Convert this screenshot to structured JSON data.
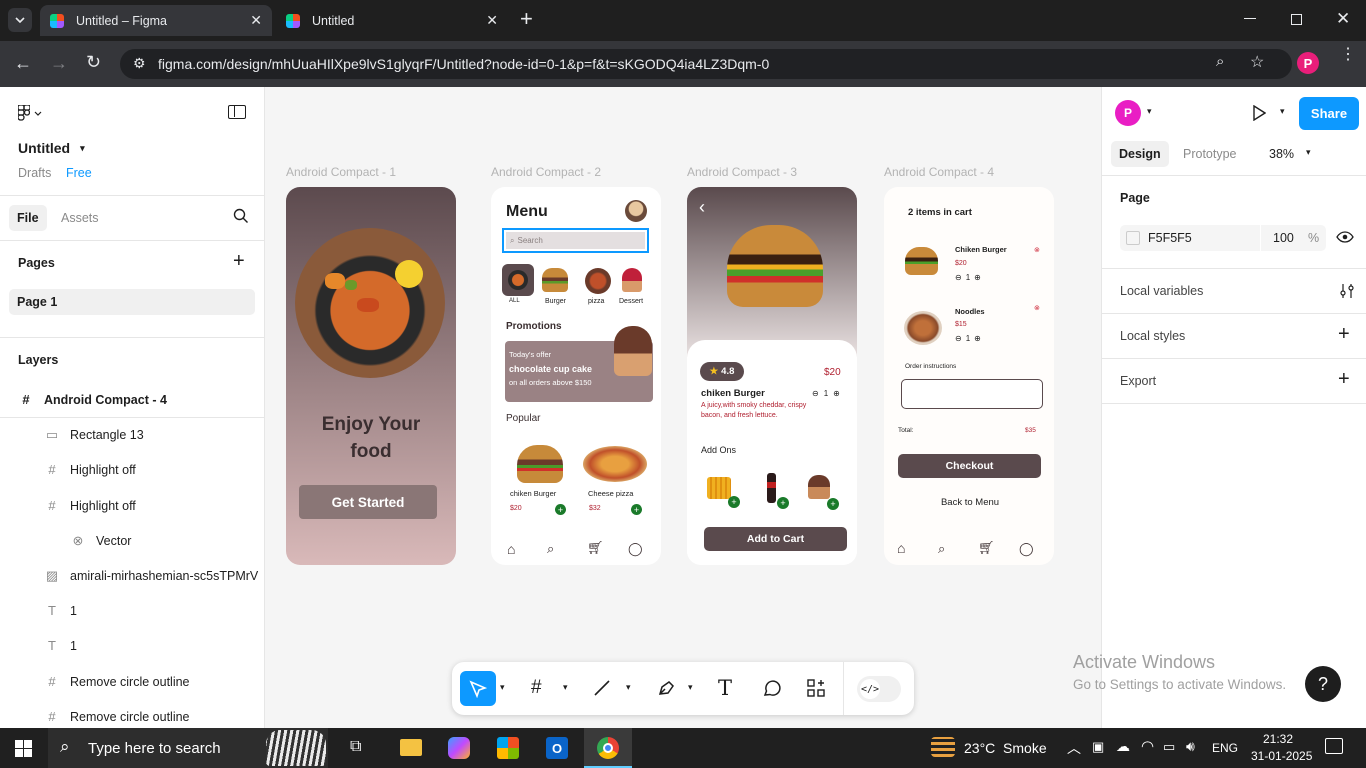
{
  "browser": {
    "tabs": [
      {
        "title": "Untitled – Figma"
      },
      {
        "title": "Untitled"
      }
    ],
    "url": "figma.com/design/mhUuaHIlXpe9lvS1glyqrF/Untitled?node-id=0-1&p=f&t=sKGODQ4ia4LZ3Dqm-0",
    "profile_initial": "P"
  },
  "figma": {
    "file_name": "Untitled",
    "drafts": "Drafts",
    "plan": "Free",
    "tabs": {
      "file": "File",
      "assets": "Assets"
    },
    "pages_heading": "Pages",
    "pages": [
      "Page 1"
    ],
    "layers_heading": "Layers",
    "layers": [
      {
        "name": "Android Compact - 4",
        "icon": "frame-icon"
      },
      {
        "name": "Rectangle 13",
        "icon": "rectangle-icon"
      },
      {
        "name": "Highlight off",
        "icon": "frame-icon"
      },
      {
        "name": "Highlight off",
        "icon": "frame-icon"
      },
      {
        "name": "Vector",
        "icon": "vector-icon"
      },
      {
        "name": "amirali-mirhashemian-sc5sTPMrV",
        "icon": "image-icon"
      },
      {
        "name": "1",
        "icon": "text-icon"
      },
      {
        "name": "1",
        "icon": "text-icon"
      },
      {
        "name": "Remove circle outline",
        "icon": "frame-icon"
      },
      {
        "name": "Remove circle outline",
        "icon": "frame-icon"
      }
    ],
    "right": {
      "avatar": "P",
      "share": "Share",
      "tab_design": "Design",
      "tab_prototype": "Prototype",
      "zoom": "38%",
      "page_label": "Page",
      "bg_color": "F5F5F5",
      "opacity": "100",
      "pct": "%",
      "local_variables": "Local variables",
      "local_styles": "Local styles",
      "export": "Export"
    },
    "watermark": {
      "title": "Activate Windows",
      "subtitle": "Go to Settings to activate Windows."
    }
  },
  "frames": {
    "f1": {
      "label": "Android Compact - 1",
      "headline_1": "Enjoy Your",
      "headline_2": "food",
      "button": "Get Started"
    },
    "f2": {
      "label": "Android Compact - 2",
      "title": "Menu",
      "search": "Search",
      "categories": [
        "ALL",
        "Burger",
        "pizza",
        "Dessert"
      ],
      "promotions": "Promotions",
      "promo_line1": "Today's offer",
      "promo_line2": "chocolate cup cake",
      "promo_line3": "on all orders above $150",
      "popular": "Popular",
      "items": [
        {
          "name": "chiken Burger",
          "price": "$20"
        },
        {
          "name": "Cheese pizza",
          "price": "$32"
        }
      ]
    },
    "f3": {
      "label": "Android Compact - 3",
      "rating": "4.8",
      "price": "$20",
      "name": "chiken Burger",
      "qty": "1",
      "desc_1": "A juicy,with smoky cheddar, crispy",
      "desc_2": "bacon, and fresh lettuce.",
      "addons": "Add Ons",
      "add_to_cart": "Add to Cart"
    },
    "f4": {
      "label": "Android Compact - 4",
      "title": "2 items in cart",
      "items": [
        {
          "name": "Chiken Burger",
          "price": "$20",
          "qty": "1"
        },
        {
          "name": "Noodles",
          "price": "$15",
          "qty": "1"
        }
      ],
      "instructions": "Order instructions",
      "total_label": "Total:",
      "total": "$35",
      "checkout": "Checkout",
      "back": "Back to Menu"
    }
  },
  "taskbar": {
    "search": "Type here to search",
    "weather": "23°C  Smoke",
    "lang": "ENG",
    "time": "21:32",
    "date": "31-01-2025"
  },
  "colors": {
    "accent": "#0d99ff",
    "brown": "#5a4a4d",
    "free": "#0d99ff"
  }
}
